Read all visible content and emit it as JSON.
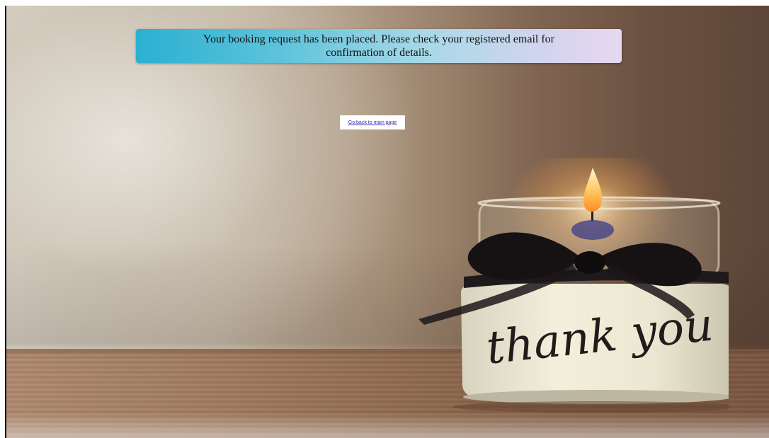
{
  "banner": {
    "message": "Your booking request has been placed. Please check your registered email for confirmation of details."
  },
  "navigation": {
    "back_link_label": "Go back to main page"
  },
  "background_image": {
    "jar_label": "thank you"
  }
}
